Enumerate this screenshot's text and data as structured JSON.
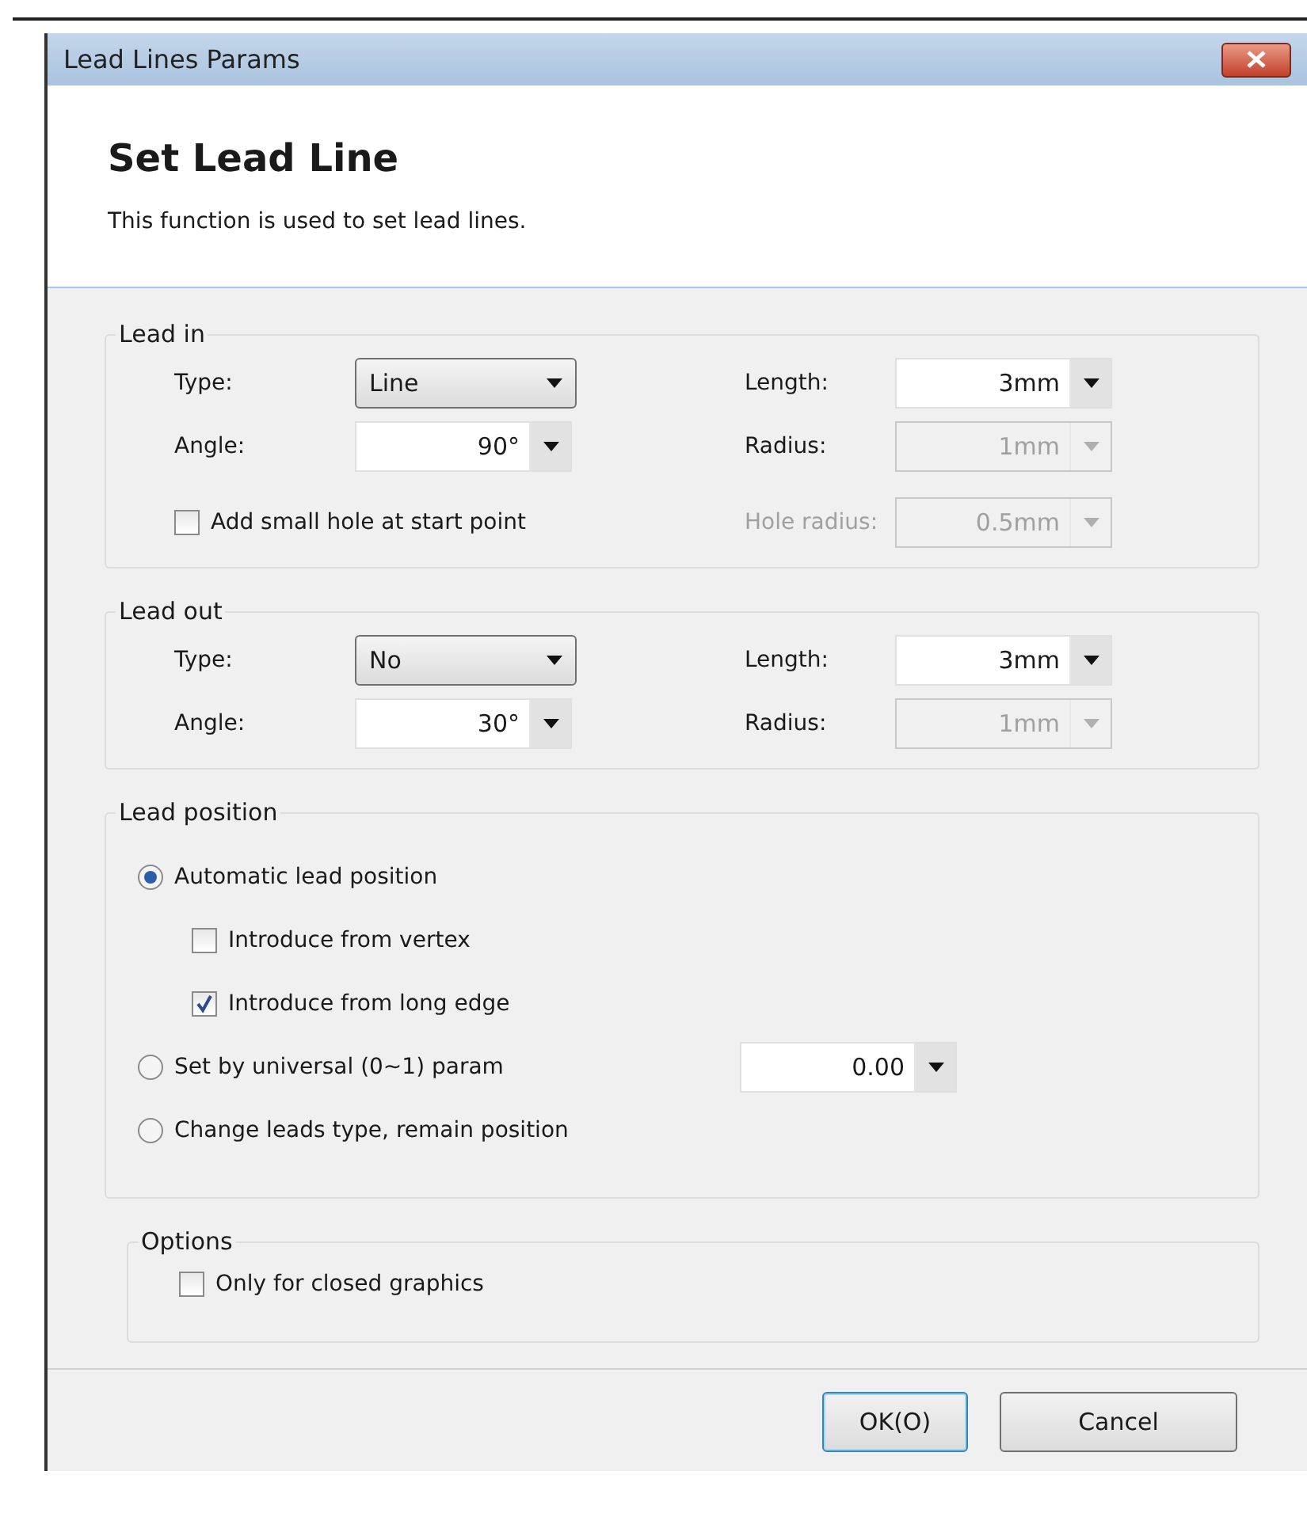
{
  "window": {
    "title": "Lead Lines Params"
  },
  "header": {
    "title": "Set Lead Line",
    "description": "This function is used to set lead lines."
  },
  "lead_in": {
    "title": "Lead in",
    "fields": [
      {
        "label": "Type:",
        "value": "Line",
        "kind": "combo",
        "disabled": false
      },
      {
        "label": "Length:",
        "value": "3mm",
        "kind": "spin",
        "disabled": false
      },
      {
        "label": "Angle:",
        "value": "90°",
        "kind": "spin",
        "disabled": false
      },
      {
        "label": "Radius:",
        "value": "1mm",
        "kind": "spin",
        "disabled": true
      }
    ],
    "hole": {
      "label": "Add small hole at start point",
      "checked": false
    },
    "hole_radius": {
      "label": "Hole radius:",
      "value": "0.5mm",
      "disabled": true
    }
  },
  "lead_out": {
    "title": "Lead out",
    "fields": [
      {
        "label": "Type:",
        "value": "No",
        "kind": "combo",
        "disabled": false
      },
      {
        "label": "Length:",
        "value": "3mm",
        "kind": "spin",
        "disabled": false
      },
      {
        "label": "Angle:",
        "value": "30°",
        "kind": "spin",
        "disabled": false
      },
      {
        "label": "Radius:",
        "value": "1mm",
        "kind": "spin",
        "disabled": true
      }
    ]
  },
  "lead_position": {
    "title": "Lead position",
    "options": [
      {
        "label": "Automatic lead position",
        "selected": true,
        "children": [
          {
            "label": "Introduce from vertex",
            "checked": false
          },
          {
            "label": "Introduce from long edge",
            "checked": true
          }
        ]
      },
      {
        "label": "Set by universal (0~1) param",
        "selected": false,
        "value": "0.00"
      },
      {
        "label": "Change leads type, remain position",
        "selected": false
      }
    ]
  },
  "options": {
    "title": "Options",
    "checkboxes": [
      {
        "label": "Only for closed graphics",
        "checked": false
      }
    ]
  },
  "buttons": [
    {
      "label": "OK(O)",
      "default": true
    },
    {
      "label": "Cancel",
      "default": false
    }
  ]
}
